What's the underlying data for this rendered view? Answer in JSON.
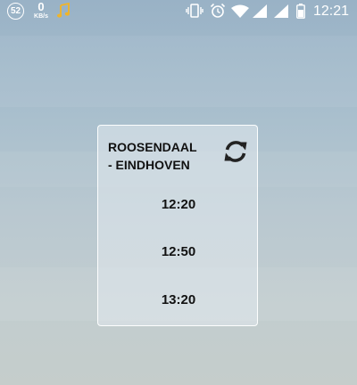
{
  "status_bar": {
    "notification_count": "52",
    "net_speed_value": "0",
    "net_speed_unit": "KB/s",
    "icons": [
      "music-note-icon",
      "vibrate-icon",
      "alarm-icon",
      "wifi-icon",
      "cell-signal-icon",
      "cell-signal-icon",
      "battery-icon"
    ],
    "time": "12:21"
  },
  "widget": {
    "route_line1": "ROOSENDAAL",
    "route_line2": "- EINDHOVEN",
    "refresh_icon": "refresh-icon",
    "departures": [
      "12:20",
      "12:50",
      "13:20"
    ]
  },
  "colors": {
    "music_icon": "#f0b429",
    "text": "#111111",
    "status_text": "#ffffff"
  }
}
